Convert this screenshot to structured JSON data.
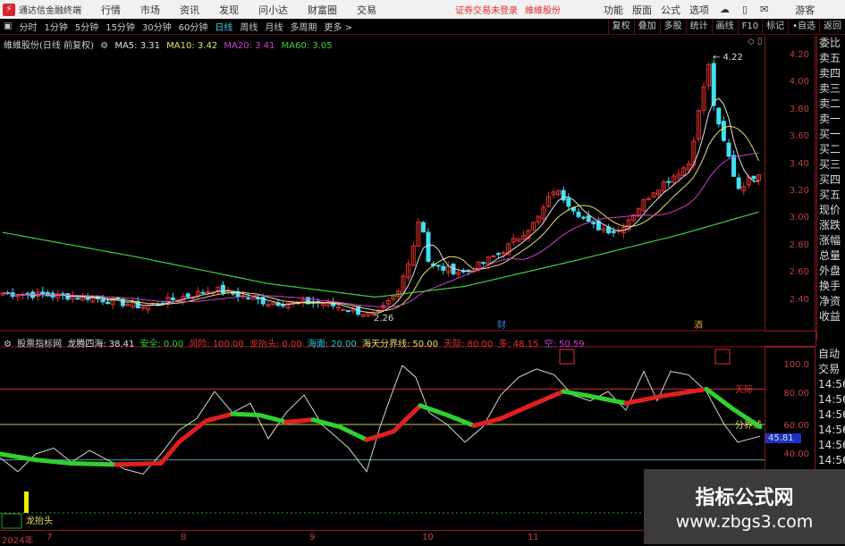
{
  "menubar": {
    "app_title": "通达信金融终端",
    "menus": [
      "行情",
      "市场",
      "资讯",
      "发现",
      "问小达",
      "财富圈",
      "交易"
    ],
    "warning": "证券交易未登录",
    "stock_link": "維維股份",
    "right_menus": [
      "功能",
      "版面",
      "公式",
      "选项"
    ],
    "user": "游客"
  },
  "toolbar": {
    "periods": [
      "分时",
      "1分钟",
      "5分钟",
      "15分钟",
      "30分钟",
      "60分钟",
      "日线",
      "周线",
      "月线",
      "多周期",
      "更多 >"
    ],
    "active_period": "日线",
    "right_buttons": [
      "复权",
      "叠加",
      "多股",
      "统计",
      "画线",
      "F10",
      "标记",
      "•自选",
      "返回"
    ]
  },
  "chart": {
    "title": "維維股份(日线 前复权)",
    "ma": [
      {
        "label": "MA5: 3.31",
        "color": "#e0e0e0"
      },
      {
        "label": "MA10: 3.42",
        "color": "#e8e070"
      },
      {
        "label": "MA20: 3.41",
        "color": "#d040d0"
      },
      {
        "label": "MA60: 3.05",
        "color": "#40d040"
      }
    ],
    "high_label": "4.22",
    "low_label": "2.26",
    "price_ticks": [
      "4.20",
      "4.00",
      "3.80",
      "3.60",
      "3.40",
      "3.20",
      "3.00",
      "2.80",
      "2.60",
      "2.40"
    ],
    "markers": [
      "财",
      "酒"
    ]
  },
  "indicator": {
    "source": "股票指标网",
    "name": "龙腾四海:",
    "value": "38.41",
    "params": [
      {
        "label": "安全:",
        "value": "0.00",
        "color": "#30d030"
      },
      {
        "label": "风险:",
        "value": "100.00",
        "color": "#e03030"
      },
      {
        "label": "龙抬头:",
        "value": "0.00",
        "color": "#e03030"
      },
      {
        "label": "海面:",
        "value": "20.00",
        "color": "#30c8d8"
      },
      {
        "label": "海天分界线:",
        "value": "50.00",
        "color": "#e8e070"
      },
      {
        "label": "天际:",
        "value": "80.00",
        "color": "#e03030"
      },
      {
        "label": "多:",
        "value": "48.15",
        "color": "#e03030"
      },
      {
        "label": "空:",
        "value": "50.59",
        "color": "#c040e0"
      }
    ],
    "ticks": [
      "100.0",
      "80.00",
      "60.00",
      "40.00"
    ],
    "tianji_label": "天际",
    "fenjie_label": "分界线",
    "current_value": "45.81",
    "longtaitou_label": "龙抬头"
  },
  "dates": [
    "2024年",
    "7",
    "8",
    "9",
    "10",
    "11"
  ],
  "right_panel": {
    "items": [
      "委比",
      "卖五",
      "卖四",
      "卖三",
      "卖二",
      "卖一",
      "买一",
      "买二",
      "买三",
      "买四",
      "买五",
      "现价",
      "涨跌",
      "涨幅",
      "总量",
      "外盘",
      "换手",
      "净资",
      "收益"
    ],
    "items2": [
      "自动",
      "交易",
      "14:56",
      "14:56",
      "14:56",
      "14:56",
      "14:56",
      "14:56"
    ]
  },
  "watermark": {
    "title": "指标公式网",
    "url": "www.zbgs3.com"
  },
  "colors": {
    "up": "#e03030",
    "down": "#40e0f0",
    "bg": "#000000"
  }
}
